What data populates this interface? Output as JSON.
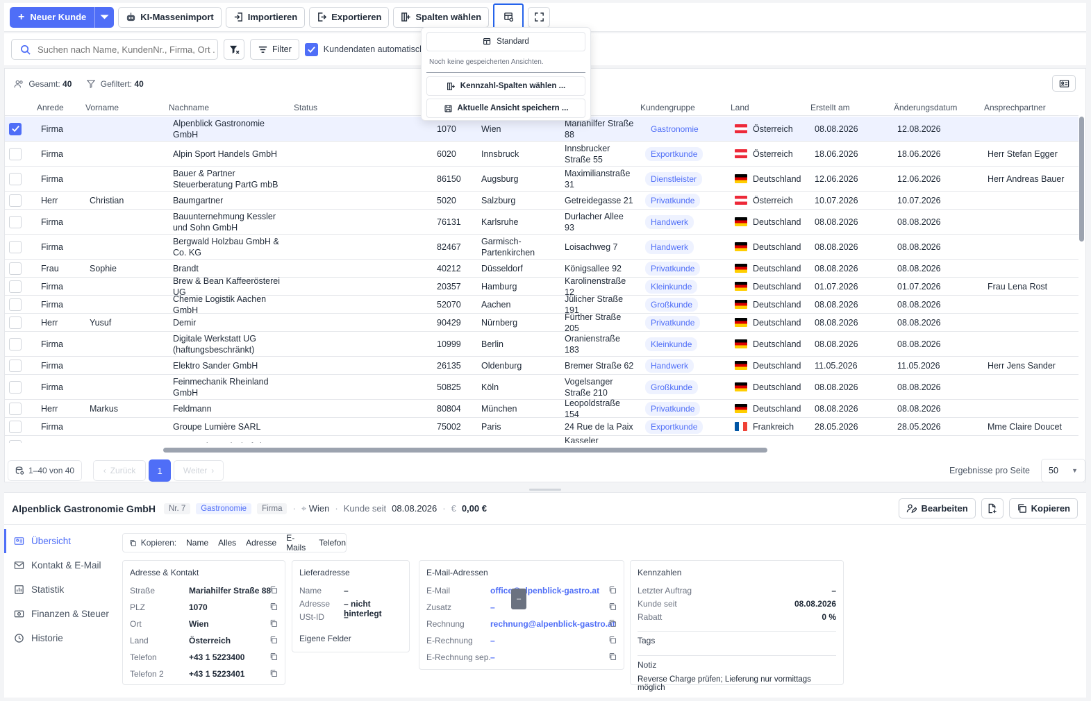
{
  "toolbar": {
    "new_customer": "Neuer Kunde",
    "ai_import": "KI-Massenimport",
    "import": "Importieren",
    "export": "Exportieren",
    "columns": "Spalten wählen"
  },
  "search": {
    "placeholder": "Suchen nach Name, KundenNr., Firma, Ort ...",
    "filter_label": "Filter",
    "autofill_label": "Kundendaten automatisch"
  },
  "views_dropdown": {
    "standard": "Standard",
    "empty_text": "Noch keine gespeicherten Ansichten.",
    "kpi_columns": "Kennzahl-Spalten wählen ...",
    "save_view": "Aktuelle Ansicht speichern ..."
  },
  "stats": {
    "total_label": "Gesamt:",
    "total": "40",
    "filtered_label": "Gefiltert:",
    "filtered": "40"
  },
  "columns": [
    "Anrede",
    "Vorname",
    "Nachname",
    "Status",
    "Kundengruppe",
    "Land",
    "Erstellt am",
    "Änderungsdatum",
    "Ansprechpartner"
  ],
  "rows": [
    {
      "anrede": "Firma",
      "vorname": "",
      "nachname": "Alpenblick Gastronomie GmbH",
      "plz": "1070",
      "ort": "Wien",
      "strasse": "Mariahilfer Straße 88",
      "gruppe": "Gastronomie",
      "land": "Österreich",
      "flag": "at",
      "erstellt": "08.08.2026",
      "geaendert": "12.08.2026",
      "ansprech": "",
      "selected": true
    },
    {
      "anrede": "Firma",
      "vorname": "",
      "nachname": "Alpin Sport Handels GmbH",
      "plz": "6020",
      "ort": "Innsbruck",
      "strasse": "Innsbrucker Straße 55",
      "gruppe": "Exportkunde",
      "land": "Österreich",
      "flag": "at",
      "erstellt": "18.06.2026",
      "geaendert": "18.06.2026",
      "ansprech": "Herr Stefan Egger"
    },
    {
      "anrede": "Firma",
      "vorname": "",
      "nachname": "Bauer & Partner Steuerberatung PartG mbB",
      "plz": "86150",
      "ort": "Augsburg",
      "strasse": "Maximilianstraße 31",
      "gruppe": "Dienstleister",
      "land": "Deutschland",
      "flag": "de",
      "erstellt": "12.06.2026",
      "geaendert": "12.06.2026",
      "ansprech": "Herr Andreas Bauer"
    },
    {
      "anrede": "Herr",
      "vorname": "Christian",
      "nachname": "Baumgartner",
      "plz": "5020",
      "ort": "Salzburg",
      "strasse": "Getreidegasse 21",
      "gruppe": "Privatkunde",
      "land": "Österreich",
      "flag": "at",
      "erstellt": "10.07.2026",
      "geaendert": "10.07.2026",
      "ansprech": ""
    },
    {
      "anrede": "Firma",
      "vorname": "",
      "nachname": "Bauunternehmung Kessler und Sohn GmbH",
      "plz": "76131",
      "ort": "Karlsruhe",
      "strasse": "Durlacher Allee 93",
      "gruppe": "Handwerk",
      "land": "Deutschland",
      "flag": "de",
      "erstellt": "08.08.2026",
      "geaendert": "08.08.2026",
      "ansprech": ""
    },
    {
      "anrede": "Firma",
      "vorname": "",
      "nachname": "Bergwald Holzbau GmbH & Co. KG",
      "plz": "82467",
      "ort": "Garmisch-Partenkirchen",
      "strasse": "Loisachweg 7",
      "gruppe": "Handwerk",
      "land": "Deutschland",
      "flag": "de",
      "erstellt": "08.08.2026",
      "geaendert": "08.08.2026",
      "ansprech": ""
    },
    {
      "anrede": "Frau",
      "vorname": "Sophie",
      "nachname": "Brandt",
      "plz": "40212",
      "ort": "Düsseldorf",
      "strasse": "Königsallee 92",
      "gruppe": "Privatkunde",
      "land": "Deutschland",
      "flag": "de",
      "erstellt": "08.08.2026",
      "geaendert": "08.08.2026",
      "ansprech": ""
    },
    {
      "anrede": "Firma",
      "vorname": "",
      "nachname": "Brew & Bean Kaffeerösterei UG",
      "plz": "20357",
      "ort": "Hamburg",
      "strasse": "Karolinenstraße 12",
      "gruppe": "Kleinkunde",
      "land": "Deutschland",
      "flag": "de",
      "erstellt": "01.07.2026",
      "geaendert": "01.07.2026",
      "ansprech": "Frau Lena Rost"
    },
    {
      "anrede": "Firma",
      "vorname": "",
      "nachname": "Chemie Logistik Aachen GmbH",
      "plz": "52070",
      "ort": "Aachen",
      "strasse": "Jülicher Straße 191",
      "gruppe": "Großkunde",
      "land": "Deutschland",
      "flag": "de",
      "erstellt": "08.08.2026",
      "geaendert": "08.08.2026",
      "ansprech": ""
    },
    {
      "anrede": "Herr",
      "vorname": "Yusuf",
      "nachname": "Demir",
      "plz": "90429",
      "ort": "Nürnberg",
      "strasse": "Fürther Straße 205",
      "gruppe": "Privatkunde",
      "land": "Deutschland",
      "flag": "de",
      "erstellt": "08.08.2026",
      "geaendert": "08.08.2026",
      "ansprech": ""
    },
    {
      "anrede": "Firma",
      "vorname": "",
      "nachname": "Digitale Werkstatt UG (haftungsbeschränkt)",
      "plz": "10999",
      "ort": "Berlin",
      "strasse": "Oranienstraße 183",
      "gruppe": "Kleinkunde",
      "land": "Deutschland",
      "flag": "de",
      "erstellt": "08.08.2026",
      "geaendert": "08.08.2026",
      "ansprech": ""
    },
    {
      "anrede": "Firma",
      "vorname": "",
      "nachname": "Elektro Sander GmbH",
      "plz": "26135",
      "ort": "Oldenburg",
      "strasse": "Bremer Straße 62",
      "gruppe": "Handwerk",
      "land": "Deutschland",
      "flag": "de",
      "erstellt": "11.05.2026",
      "geaendert": "11.05.2026",
      "ansprech": "Herr Jens Sander"
    },
    {
      "anrede": "Firma",
      "vorname": "",
      "nachname": "Feinmechanik Rheinland GmbH",
      "plz": "50825",
      "ort": "Köln",
      "strasse": "Vogelsanger Straße 210",
      "gruppe": "Großkunde",
      "land": "Deutschland",
      "flag": "de",
      "erstellt": "08.08.2026",
      "geaendert": "08.08.2026",
      "ansprech": ""
    },
    {
      "anrede": "Herr",
      "vorname": "Markus",
      "nachname": "Feldmann",
      "plz": "80804",
      "ort": "München",
      "strasse": "Leopoldstraße 154",
      "gruppe": "Privatkunde",
      "land": "Deutschland",
      "flag": "de",
      "erstellt": "08.08.2026",
      "geaendert": "08.08.2026",
      "ansprech": ""
    },
    {
      "anrede": "Firma",
      "vorname": "",
      "nachname": "Groupe Lumière SARL",
      "plz": "75002",
      "ort": "Paris",
      "strasse": "24 Rue de la Paix",
      "gruppe": "Exportkunde",
      "land": "Frankreich",
      "flag": "fr",
      "erstellt": "28.05.2026",
      "geaendert": "28.05.2026",
      "ansprech": "Mme Claire Doucet"
    },
    {
      "anrede": "",
      "vorname": "",
      "nachname": "Grünwerk Landschaftsbau",
      "plz": "",
      "ort": "",
      "strasse": "Kasseler Landstraße",
      "gruppe": "",
      "land": "",
      "flag": "de",
      "erstellt": "",
      "geaendert": "",
      "ansprech": ""
    }
  ],
  "pager": {
    "range": "1–40 von 40",
    "prev": "Zurück",
    "page": "1",
    "next": "Weiter",
    "per_page_label": "Ergebnisse pro Seite",
    "per_page": "50"
  },
  "detail": {
    "name": "Alpenblick Gastronomie GmbH",
    "nr": "Nr. 7",
    "group": "Gastronomie",
    "type": "Firma",
    "city": "Wien",
    "since_label": "Kunde seit",
    "since": "08.08.2026",
    "revenue": "0,00 €",
    "edit": "Bearbeiten",
    "copy": "Kopieren",
    "nav": [
      "Übersicht",
      "Kontakt & E-Mail",
      "Statistik",
      "Finanzen & Steuer",
      "Historie"
    ],
    "copybar": {
      "label": "Kopieren:",
      "items": [
        "Name",
        "Alles",
        "Adresse",
        "E-Mails",
        "Telefon"
      ]
    },
    "address": {
      "title": "Adresse & Kontakt",
      "fields": [
        {
          "k": "Straße",
          "v": "Mariahilfer Straße 88"
        },
        {
          "k": "PLZ",
          "v": "1070"
        },
        {
          "k": "Ort",
          "v": "Wien"
        },
        {
          "k": "Land",
          "v": "Österreich"
        },
        {
          "k": "Telefon",
          "v": "+43 1 5223400"
        },
        {
          "k": "Telefon 2",
          "v": "+43 1 5223401"
        }
      ]
    },
    "delivery": {
      "title": "Lieferadresse",
      "fields": [
        {
          "k": "Name",
          "v": "–"
        },
        {
          "k": "Adresse",
          "v": "– nicht hinterlegt"
        },
        {
          "k": "USt-ID",
          "v": "–"
        }
      ],
      "custom": "Eigene Felder"
    },
    "emails": {
      "title": "E-Mail-Adressen",
      "fields": [
        {
          "k": "E-Mail",
          "v": "office@alpenblick-gastro.at"
        },
        {
          "k": "Zusatz",
          "v": "–"
        },
        {
          "k": "Rechnung",
          "v": "rechnung@alpenblick-gastro.at"
        },
        {
          "k": "E-Rechnung",
          "v": "–"
        },
        {
          "k": "E-Rechnung sep.",
          "v": "–"
        }
      ]
    },
    "kpi": {
      "title": "Kennzahlen",
      "fields": [
        {
          "k": "Letzter Auftrag",
          "v": "–"
        },
        {
          "k": "Kunde seit",
          "v": "08.08.2026"
        },
        {
          "k": "Rabatt",
          "v": "0 %"
        }
      ],
      "tags": "Tags",
      "note_label": "Notiz",
      "note": "Reverse Charge prüfen; Lieferung nur vormittags möglich"
    },
    "tooltip": "–"
  }
}
